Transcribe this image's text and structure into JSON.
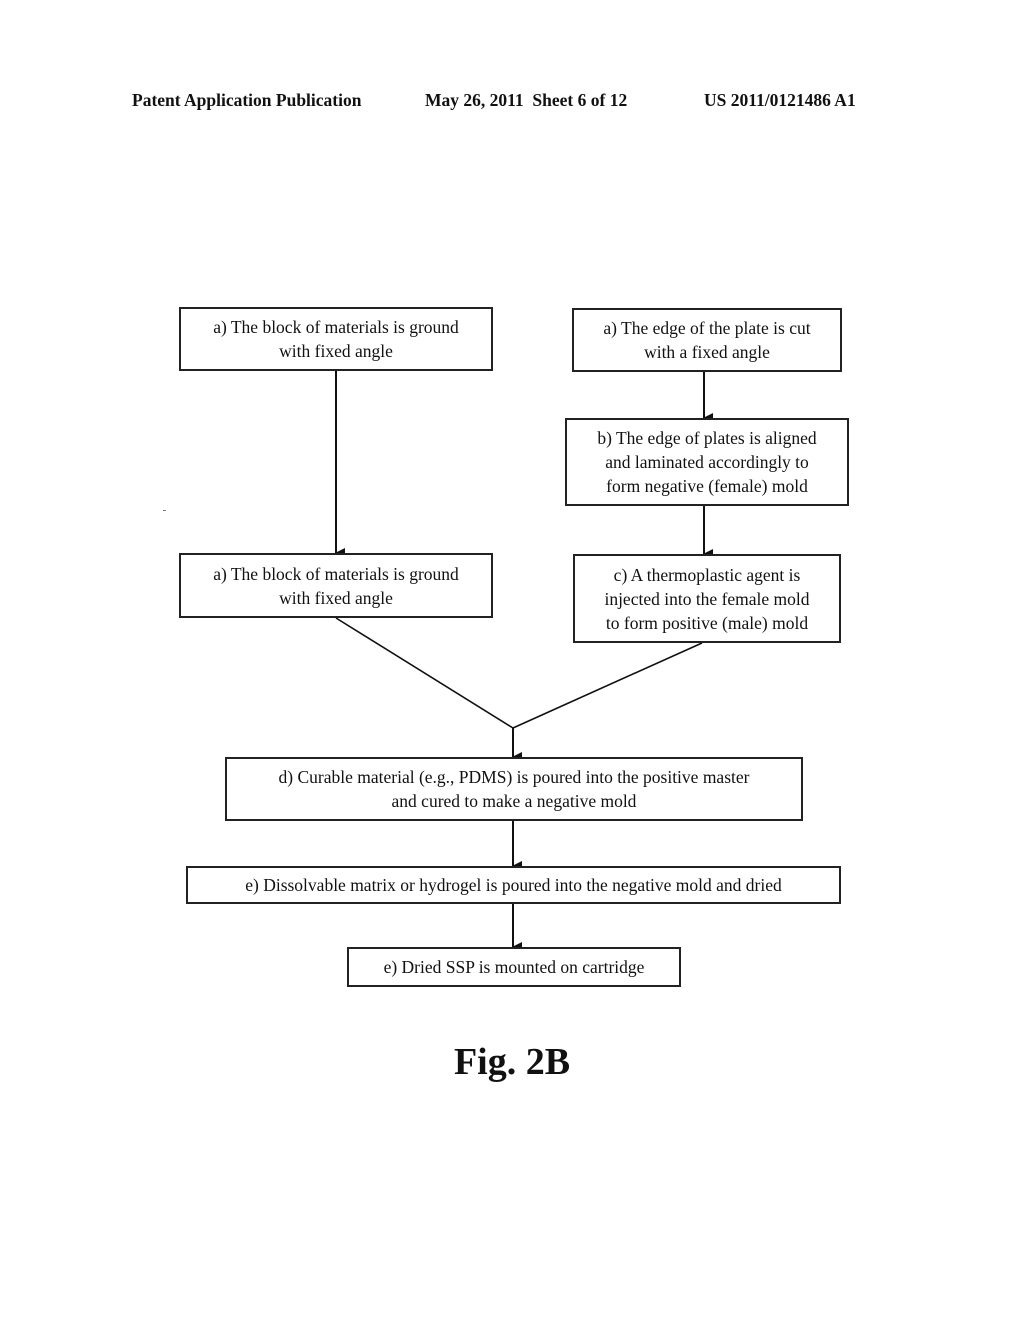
{
  "header": {
    "publication": "Patent Application Publication",
    "date_sheet": "May 26, 2011  Sheet 6 of 12",
    "patent_number": "US 2011/0121486 A1"
  },
  "flowchart": {
    "left_top": {
      "line1": "a) The block of materials is ground",
      "line2": "with fixed angle"
    },
    "left_bottom": {
      "line1": "a) The block of materials is ground",
      "line2": "with fixed angle"
    },
    "right_a": {
      "line1": "a) The edge of the plate is cut",
      "line2": "with a fixed angle"
    },
    "right_b": {
      "line1": "b) The edge of plates is aligned",
      "line2": "and laminated accordingly to",
      "line3": "form negative (female) mold"
    },
    "right_c": {
      "line1": "c) A thermoplastic agent is",
      "line2": "injected into the female mold",
      "line3": "to form positive (male) mold"
    },
    "step_d": {
      "line1": "d) Curable material (e.g., PDMS) is poured into the positive master",
      "line2": "and cured to make a negative mold"
    },
    "step_e1": {
      "line1": "e) Dissolvable matrix or hydrogel is poured into the negative mold and dried"
    },
    "step_e2": {
      "line1": "e) Dried SSP is mounted on cartridge"
    }
  },
  "figure_label": "Fig. 2B"
}
